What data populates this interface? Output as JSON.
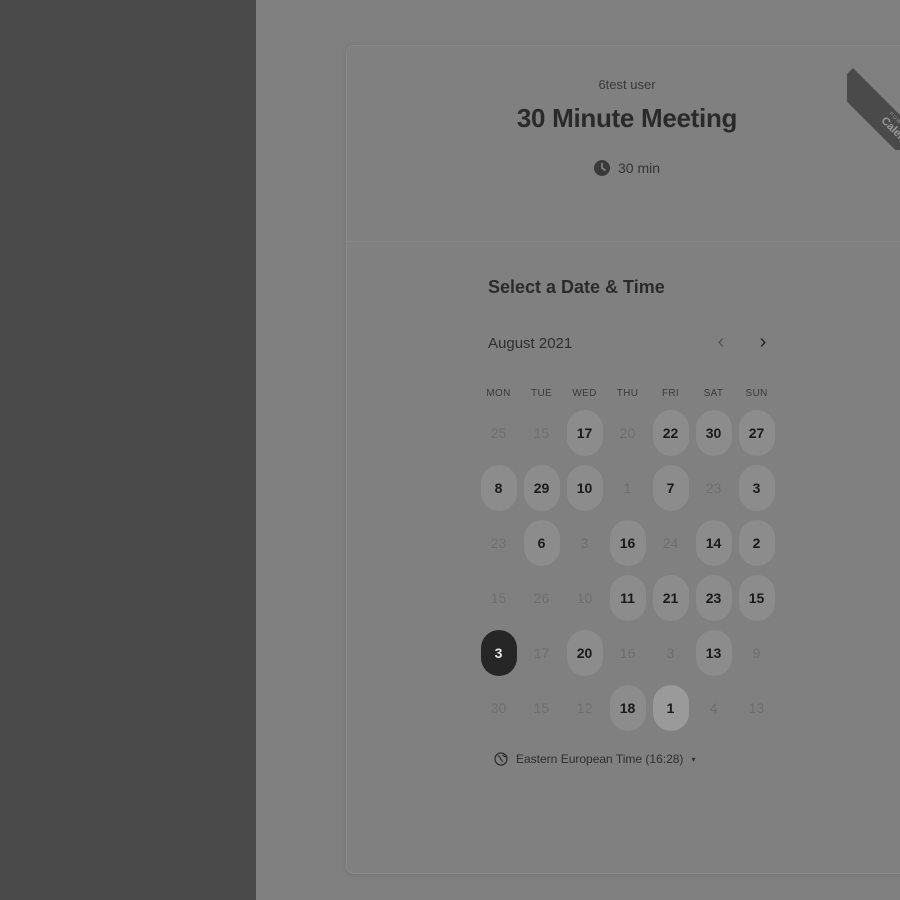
{
  "event": {
    "owner": "6test user",
    "title": "30 Minute Meeting",
    "duration": "30 min"
  },
  "badge": {
    "small_text": "POWERED BY",
    "brand": "Calendly"
  },
  "picker": {
    "title": "Select a Date & Time",
    "month": "August 2021",
    "prev_label": "‹",
    "next_label": "›",
    "weekdays": [
      "MON",
      "TUE",
      "WED",
      "THU",
      "FRI",
      "SAT",
      "SUN"
    ],
    "days": [
      {
        "label": "25",
        "available": false
      },
      {
        "label": "15",
        "available": false
      },
      {
        "label": "17",
        "available": true
      },
      {
        "label": "20",
        "available": false
      },
      {
        "label": "22",
        "available": true
      },
      {
        "label": "30",
        "available": true
      },
      {
        "label": "27",
        "available": true
      },
      {
        "label": "8",
        "available": true
      },
      {
        "label": "29",
        "available": true
      },
      {
        "label": "10",
        "available": true
      },
      {
        "label": "1",
        "available": false
      },
      {
        "label": "7",
        "available": true
      },
      {
        "label": "23",
        "available": false
      },
      {
        "label": "3",
        "available": true
      },
      {
        "label": "23",
        "available": false
      },
      {
        "label": "6",
        "available": true
      },
      {
        "label": "3",
        "available": false
      },
      {
        "label": "16",
        "available": true
      },
      {
        "label": "24",
        "available": false
      },
      {
        "label": "14",
        "available": true
      },
      {
        "label": "2",
        "available": true
      },
      {
        "label": "15",
        "available": false
      },
      {
        "label": "26",
        "available": false
      },
      {
        "label": "10",
        "available": false
      },
      {
        "label": "11",
        "available": true
      },
      {
        "label": "21",
        "available": true
      },
      {
        "label": "23",
        "available": true
      },
      {
        "label": "15",
        "available": true
      },
      {
        "label": "3",
        "available": true,
        "selected": true
      },
      {
        "label": "17",
        "available": false
      },
      {
        "label": "20",
        "available": true
      },
      {
        "label": "16",
        "available": false
      },
      {
        "label": "3",
        "available": false
      },
      {
        "label": "13",
        "available": true
      },
      {
        "label": "9",
        "available": false
      },
      {
        "label": "30",
        "available": false
      },
      {
        "label": "15",
        "available": false
      },
      {
        "label": "12",
        "available": false
      },
      {
        "label": "18",
        "available": true
      },
      {
        "label": "1",
        "available": true,
        "today": true
      },
      {
        "label": "4",
        "available": false
      },
      {
        "label": "13",
        "available": false
      }
    ],
    "timezone": "Eastern European Time (16:28)",
    "timezone_caret": "▾"
  },
  "colors": {
    "overlay": "#808080",
    "sidebar": "#4a4a4a",
    "selected_day": "#262626",
    "available_day": "#8c8c8c"
  },
  "icons": {
    "duration": "clock-icon",
    "timezone": "globe-icon",
    "prev": "chevron-left-icon",
    "next": "chevron-right-icon"
  }
}
